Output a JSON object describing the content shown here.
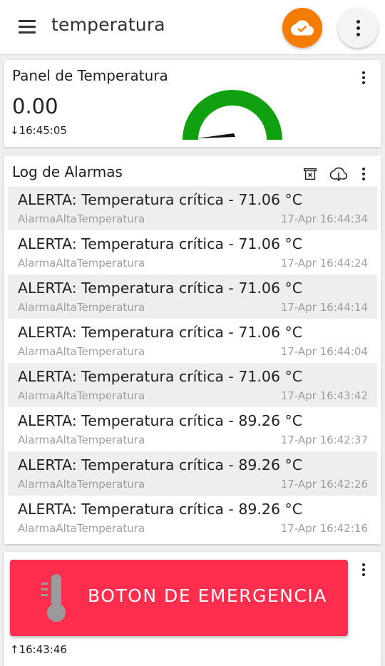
{
  "app": {
    "title": "temperatura",
    "accent_color": "#f57c00",
    "icons": [
      "menu-icon",
      "cloud-done-icon",
      "more-vert-icon"
    ]
  },
  "temperature_panel": {
    "title": "Panel de Temperatura",
    "value": "0.00",
    "timestamp": "16:45:05",
    "timestamp_direction": "down",
    "gauge_color": "#10a010"
  },
  "alarm_log": {
    "title": "Log de Alarmas",
    "actions": [
      "clear-log-icon",
      "download-icon",
      "more-vert-icon"
    ],
    "entries": [
      {
        "message": "ALERTA: Temperatura crítica - 71.06 °C",
        "source": "AlarmaAltaTemperatura",
        "timestamp": "17-Apr 16:44:34"
      },
      {
        "message": "ALERTA: Temperatura crítica - 71.06 °C",
        "source": "AlarmaAltaTemperatura",
        "timestamp": "17-Apr 16:44:24"
      },
      {
        "message": "ALERTA: Temperatura crítica - 71.06 °C",
        "source": "AlarmaAltaTemperatura",
        "timestamp": "17-Apr 16:44:14"
      },
      {
        "message": "ALERTA: Temperatura crítica - 71.06 °C",
        "source": "AlarmaAltaTemperatura",
        "timestamp": "17-Apr 16:44:04"
      },
      {
        "message": "ALERTA: Temperatura crítica - 71.06 °C",
        "source": "AlarmaAltaTemperatura",
        "timestamp": "17-Apr 16:43:42"
      },
      {
        "message": "ALERTA: Temperatura crítica - 89.26 °C",
        "source": "AlarmaAltaTemperatura",
        "timestamp": "17-Apr 16:42:37"
      },
      {
        "message": "ALERTA: Temperatura crítica - 89.26 °C",
        "source": "AlarmaAltaTemperatura",
        "timestamp": "17-Apr 16:42:26"
      },
      {
        "message": "ALERTA: Temperatura crítica - 89.26 °C",
        "source": "AlarmaAltaTemperatura",
        "timestamp": "17-Apr 16:42:16"
      }
    ]
  },
  "emergency": {
    "label": "BOTON DE EMERGENCIA",
    "color": "#ff2d4e",
    "timestamp": "16:43:46",
    "timestamp_direction": "up",
    "icon": "thermometer-icon"
  }
}
